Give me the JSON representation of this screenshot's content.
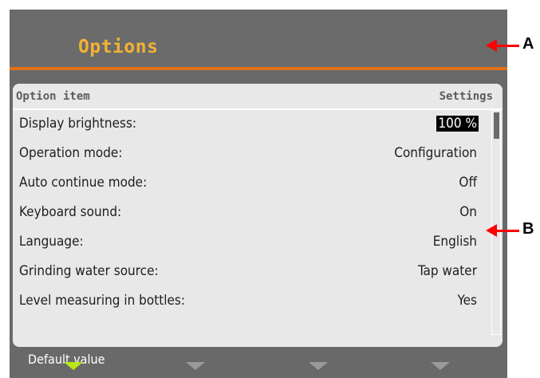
{
  "header": {
    "title": "Options"
  },
  "table": {
    "col_left": "Option item",
    "col_right": "Settings",
    "rows": [
      {
        "label": "Display brightness:",
        "value": "100 %",
        "selected": true
      },
      {
        "label": "Operation mode:",
        "value": "Configuration"
      },
      {
        "label": "Auto continue mode:",
        "value": "Off"
      },
      {
        "label": "Keyboard sound:",
        "value": "On"
      },
      {
        "label": "Language:",
        "value": "English"
      },
      {
        "label": "Grinding water source:",
        "value": "Tap water"
      },
      {
        "label": "Level measuring in bottles:",
        "value": "Yes"
      }
    ]
  },
  "footer": {
    "label": "Default value",
    "softkeys": [
      "active",
      "inactive",
      "inactive",
      "inactive"
    ]
  },
  "annotations": {
    "a": "A",
    "b": "B"
  },
  "colors": {
    "title": "#f3b233",
    "accent_rule": "#e06f1a",
    "active_softkey": "#b8e61a",
    "annotation_arrow": "#ff0000"
  }
}
